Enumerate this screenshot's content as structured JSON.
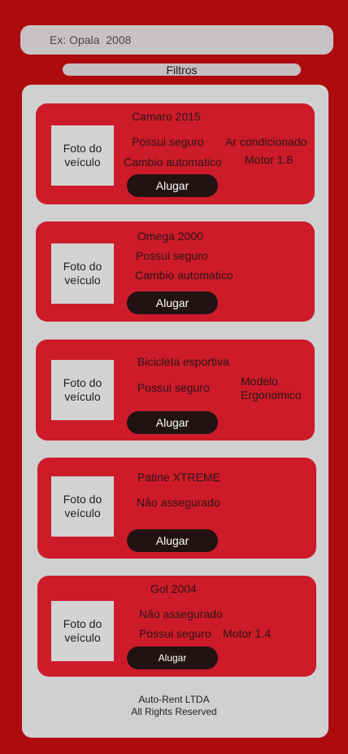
{
  "search": {
    "placeholder": "Ex: Opala  2008"
  },
  "filters": {
    "label": "Filtros"
  },
  "photo_label": {
    "line1": "Foto do",
    "line2": "veículo"
  },
  "cars": [
    {
      "title": "Camaro 2015",
      "f1": "Possui seguro",
      "f2": "Ar condicionado",
      "f3": "Cambio automatico",
      "f4": "Motor 1.8",
      "button": "Alugar"
    },
    {
      "title": "Omega 2000",
      "f1": "Possui seguro",
      "f2": "Cambio automatico",
      "button": "Alugar"
    },
    {
      "title": "Bicicleta esportiva",
      "f1": "Possui seguro",
      "f2a": "Modelo",
      "f2b": "Ergonomico",
      "button": "Alugar"
    },
    {
      "title": "Patine XTREME",
      "f1": "Não assegurado",
      "button": "Alugar"
    },
    {
      "title": "Gol 2004",
      "f1": "Não assegurado",
      "f2": "Possui seguro",
      "f3": "Motor 1.4",
      "button": "Alugar"
    }
  ],
  "footer": {
    "line1": "Auto-Rent LTDA",
    "line2": "All Rights Reserved"
  }
}
